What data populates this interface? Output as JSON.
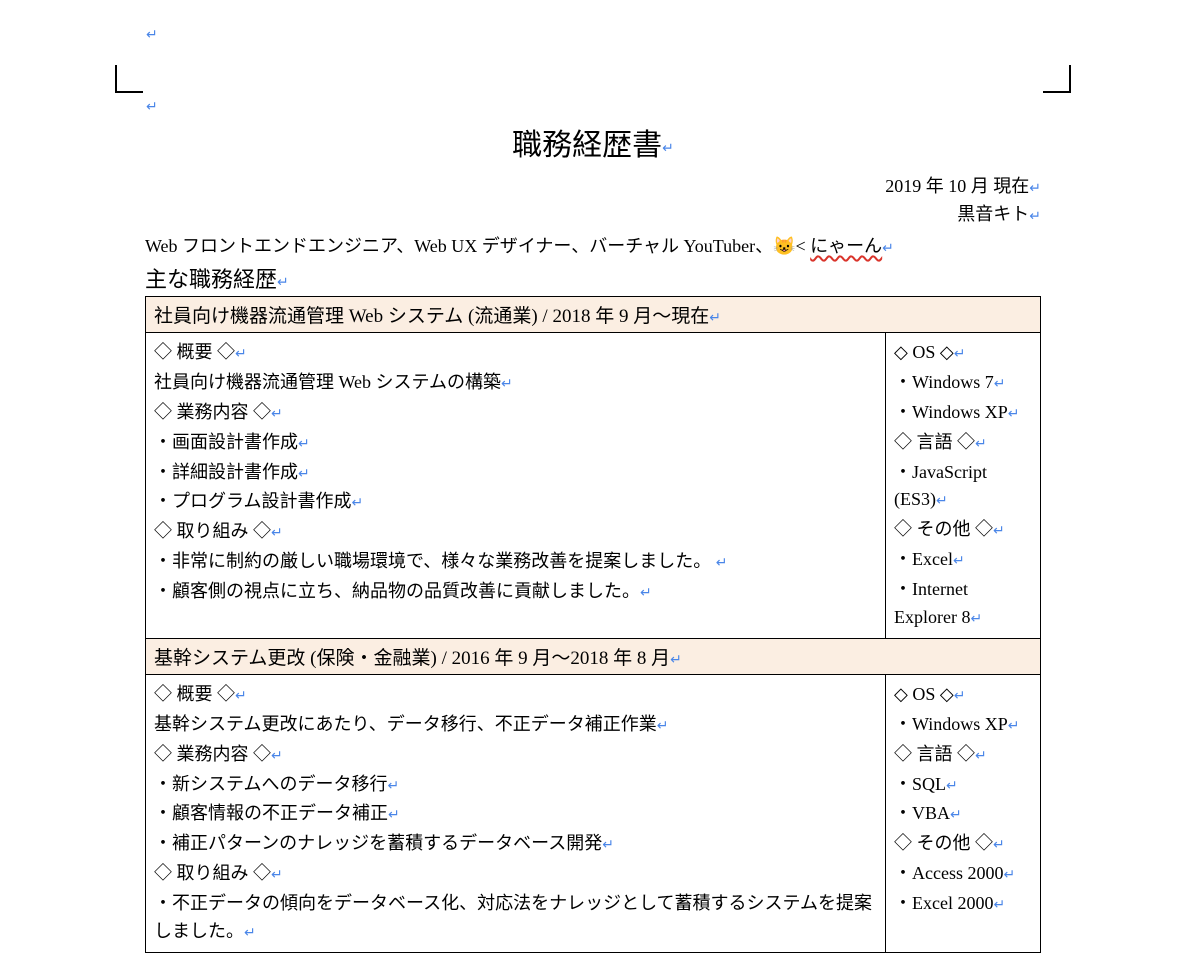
{
  "header": {
    "title": "職務経歴書",
    "date": "2019 年 10 月 現在",
    "name": "黒音キト",
    "role_line_prefix": "Web フロントエンドエンジニア、Web UX デザイナー、バーチャル YouTuber、",
    "role_line_emoji": "😺",
    "role_line_mid": "< ",
    "role_line_squiggle": "にゃーん"
  },
  "section_heading": "主な職務経歴",
  "projects": [
    {
      "title": "社員向け機器流通管理 Web システム (流通業) / 2018 年 9 月〜現在",
      "left": {
        "overview_label": "◇ 概要 ◇",
        "overview_text": "社員向け機器流通管理 Web システムの構築",
        "work_label": "◇ 業務内容 ◇",
        "work_items": [
          "・画面設計書作成",
          "・詳細設計書作成",
          "・プログラム設計書作成"
        ],
        "effort_label": "◇ 取り組み ◇",
        "effort_items": [
          "・非常に制約の厳しい職場環境で、様々な業務改善を提案しました。",
          "・顧客側の視点に立ち、納品物の品質改善に貢献しました。"
        ]
      },
      "right": {
        "os_label": "◇ OS ◇",
        "os_items": [
          "・Windows 7",
          "・Windows XP"
        ],
        "lang_label": "◇ 言語 ◇",
        "lang_items": [
          "・JavaScript (ES3)"
        ],
        "other_label": "◇ その他 ◇",
        "other_items": [
          "・Excel",
          "・Internet Explorer 8"
        ]
      }
    },
    {
      "title": "基幹システム更改 (保険・金融業) / 2016 年 9 月〜2018 年 8 月",
      "left": {
        "overview_label": "◇ 概要 ◇",
        "overview_text": "基幹システム更改にあたり、データ移行、不正データ補正作業",
        "work_label": "◇ 業務内容 ◇",
        "work_items": [
          "・新システムへのデータ移行",
          "・顧客情報の不正データ補正",
          "・補正パターンのナレッジを蓄積するデータベース開発"
        ],
        "effort_label": "◇ 取り組み ◇",
        "effort_items": [
          "・不正データの傾向をデータベース化、対応法をナレッジとして蓄積するシステムを提案しました。"
        ]
      },
      "right": {
        "os_label": "◇ OS ◇",
        "os_items": [
          "・Windows XP"
        ],
        "lang_label": "◇ 言語 ◇",
        "lang_items": [
          "・SQL",
          "・VBA"
        ],
        "other_label": "◇ その他 ◇",
        "other_items": [
          "・Access 2000",
          "・Excel 2000"
        ]
      }
    }
  ],
  "marks": {
    "pilcrow": "↵"
  }
}
